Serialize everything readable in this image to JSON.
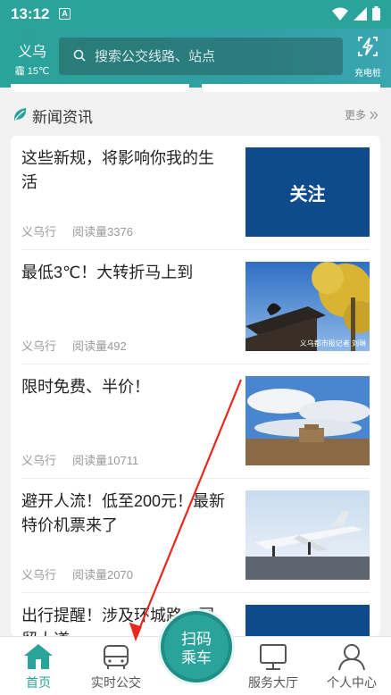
{
  "status_bar": {
    "time": "13:12",
    "sim_label": "A"
  },
  "header": {
    "city": "义乌",
    "weather": "霾 15℃",
    "search_placeholder": "搜索公交线路、站点",
    "charge_label": "充电桩"
  },
  "news_section": {
    "title": "新闻资讯",
    "more_label": "更多"
  },
  "news": [
    {
      "headline": "这些新规，将影响你我的生活",
      "source": "义乌行",
      "reads": "阅读量3376",
      "thumb_text": "关注"
    },
    {
      "headline": "最低3℃！大转折马上到",
      "source": "义乌行",
      "reads": "阅读量492",
      "thumb_caption": "义乌都市报记者 刘琳"
    },
    {
      "headline": "限时免费、半价！",
      "source": "义乌行",
      "reads": "阅读量10711"
    },
    {
      "headline": "避开人流！低至200元！最新特价机票来了",
      "source": "义乌行",
      "reads": "阅读量2070"
    },
    {
      "headline": "出行提醒！涉及环城路、国贸大道",
      "source": "",
      "reads": ""
    }
  ],
  "bottom_nav": {
    "home": "首页",
    "realtime_bus": "实时公交",
    "scan_line1": "扫码",
    "scan_line2": "乘车",
    "service_hall": "服务大厅",
    "profile": "个人中心"
  },
  "colors": {
    "accent": "#2aa39a",
    "annotation": "#e8281e"
  }
}
